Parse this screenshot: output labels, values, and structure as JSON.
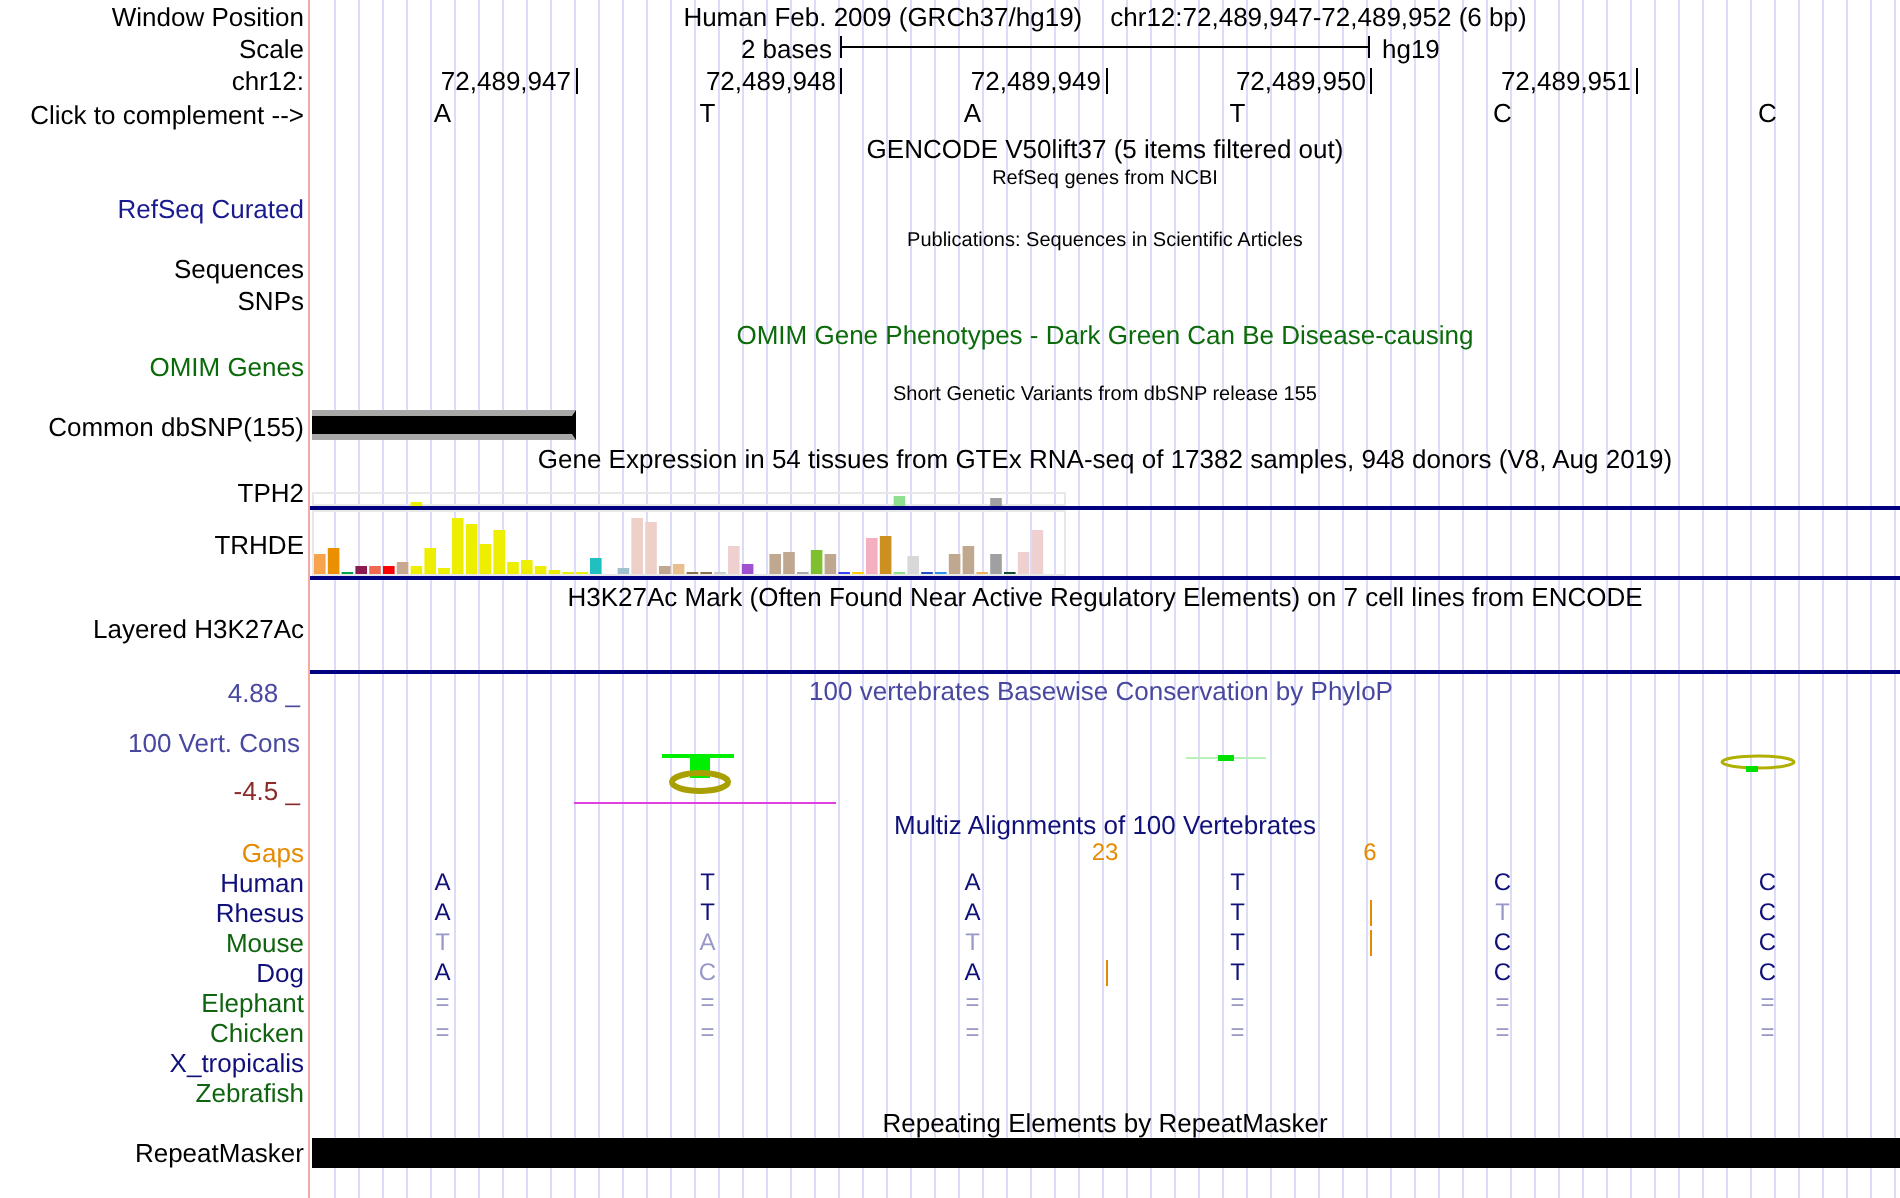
{
  "position_bar": {
    "label": "Window Position",
    "assembly": "Human Feb. 2009 (GRCh37/hg19)",
    "range": "chr12:72,489,947-72,489,952 (6 bp)"
  },
  "scale": {
    "label": "Scale",
    "span": "2 bases",
    "assembly": "hg19"
  },
  "coordinates": {
    "label": "chr12:",
    "ticks": [
      "72,489,947",
      "72,489,948",
      "72,489,949",
      "72,489,950",
      "72,489,951"
    ]
  },
  "complement": {
    "label": "Click to complement -->",
    "bases": [
      "A",
      "T",
      "A",
      "T",
      "C",
      "C"
    ]
  },
  "tracks": [
    {
      "kind": "gencode",
      "title": "GENCODE V50lift37 (5 items filtered out)"
    },
    {
      "kind": "refseq",
      "title": "RefSeq genes from NCBI",
      "label": "RefSeq Curated"
    },
    {
      "kind": "publications",
      "title": "Publications: Sequences in Scientific Articles",
      "label": "Sequences"
    },
    {
      "kind": "snps",
      "label": "SNPs"
    },
    {
      "kind": "omim",
      "title": "OMIM Gene Phenotypes - Dark Green Can Be Disease-causing",
      "label": "OMIM Genes"
    },
    {
      "kind": "dbsnp",
      "title": "Short Genetic Variants from dbSNP release 155",
      "label": "Common dbSNP(155)"
    },
    {
      "kind": "gtex",
      "title": "Gene Expression in 54 tissues from GTEx RNA-seq of 17382 samples, 948 donors (V8, Aug 2019)",
      "genes": [
        {
          "name": "TPH2"
        },
        {
          "name": "TRHDE"
        }
      ]
    },
    {
      "kind": "h3k27ac",
      "title": "H3K27Ac Mark (Often Found Near Active Regulatory Elements) on 7 cell lines from ENCODE",
      "label": "Layered H3K27Ac"
    },
    {
      "kind": "conservation",
      "title": "100 vertebrates Basewise Conservation by PhyloP",
      "label": "100 Vert. Cons",
      "max": "4.88 _",
      "min": "-4.5 _"
    },
    {
      "kind": "multiz",
      "title": "Multiz Alignments of 100 Vertebrates",
      "gaps_label": "Gaps",
      "gap_counts": [
        {
          "count": "23"
        },
        {
          "count": "6"
        }
      ],
      "species": [
        {
          "name": "Human",
          "color": "#10107a",
          "bases": [
            {
              "base": "A",
              "match": true,
              "insert_after": false
            },
            {
              "base": "T",
              "match": true,
              "insert_after": false
            },
            {
              "base": "A",
              "match": true,
              "insert_after": false
            },
            {
              "base": "T",
              "match": true,
              "insert_after": false
            },
            {
              "base": "C",
              "match": true,
              "insert_after": false
            },
            {
              "base": "C",
              "match": true,
              "insert_after": false
            }
          ]
        },
        {
          "name": "Rhesus",
          "color": "#10107a",
          "bases": [
            {
              "base": "A",
              "match": true,
              "insert_after": false
            },
            {
              "base": "T",
              "match": true,
              "insert_after": false
            },
            {
              "base": "A",
              "match": true,
              "insert_after": false
            },
            {
              "base": "T",
              "match": true,
              "insert_after": true
            },
            {
              "base": "T",
              "match": false,
              "insert_after": false
            },
            {
              "base": "C",
              "match": true,
              "insert_after": false
            }
          ]
        },
        {
          "name": "Mouse",
          "color": "#106410",
          "bases": [
            {
              "base": "T",
              "match": false,
              "insert_after": false
            },
            {
              "base": "A",
              "match": false,
              "insert_after": false
            },
            {
              "base": "T",
              "match": false,
              "insert_after": false
            },
            {
              "base": "T",
              "match": true,
              "insert_after": true
            },
            {
              "base": "C",
              "match": true,
              "insert_after": false
            },
            {
              "base": "C",
              "match": true,
              "insert_after": false
            }
          ]
        },
        {
          "name": "Dog",
          "color": "#10107a",
          "bases": [
            {
              "base": "A",
              "match": true,
              "insert_after": false
            },
            {
              "base": "C",
              "match": false,
              "insert_after": false
            },
            {
              "base": "A",
              "match": true,
              "insert_after": true
            },
            {
              "base": "T",
              "match": true,
              "insert_after": false
            },
            {
              "base": "C",
              "match": true,
              "insert_after": false
            },
            {
              "base": "C",
              "match": true,
              "insert_after": false
            }
          ]
        },
        {
          "name": "Elephant",
          "color": "#106410",
          "bases": [
            {
              "base": "=",
              "match": false,
              "insert_after": false
            },
            {
              "base": "=",
              "match": false,
              "insert_after": false
            },
            {
              "base": "=",
              "match": false,
              "insert_after": false
            },
            {
              "base": "=",
              "match": false,
              "insert_after": false
            },
            {
              "base": "=",
              "match": false,
              "insert_after": false
            },
            {
              "base": "=",
              "match": false,
              "insert_after": false
            }
          ]
        },
        {
          "name": "Chicken",
          "color": "#106410",
          "bases": [
            {
              "base": "=",
              "match": false,
              "insert_after": false
            },
            {
              "base": "=",
              "match": false,
              "insert_after": false
            },
            {
              "base": "=",
              "match": false,
              "insert_after": false
            },
            {
              "base": "=",
              "match": false,
              "insert_after": false
            },
            {
              "base": "=",
              "match": false,
              "insert_after": false
            },
            {
              "base": "=",
              "match": false,
              "insert_after": false
            }
          ]
        },
        {
          "name": "X_tropicalis",
          "color": "#10107a"
        },
        {
          "name": "Zebrafish",
          "color": "#106410"
        }
      ]
    },
    {
      "kind": "repeatmasker",
      "title": "Repeating Elements by RepeatMasker",
      "label": "RepeatMasker"
    }
  ]
}
